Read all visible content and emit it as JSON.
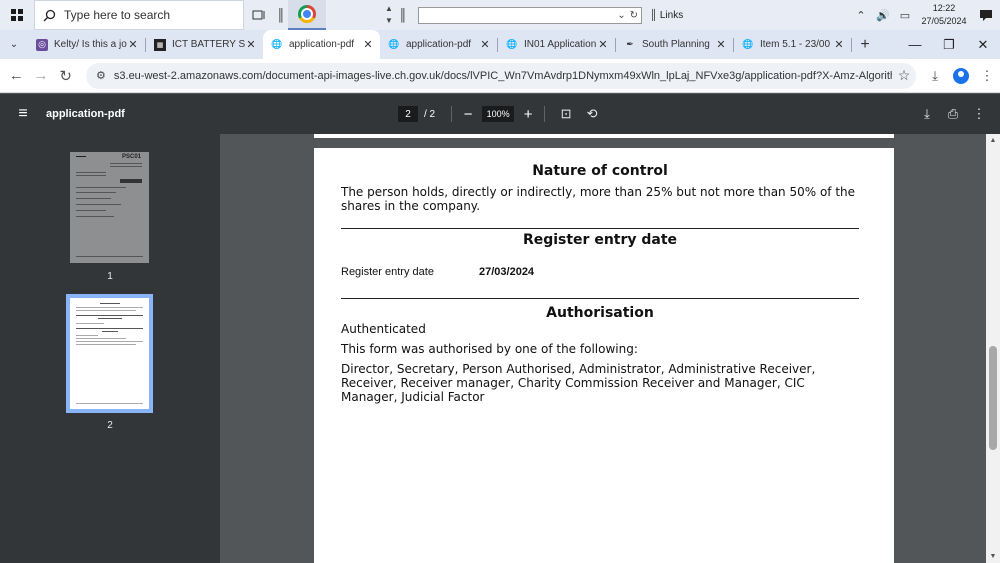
{
  "taskbar": {
    "search_placeholder": "Type here to search",
    "links_label": "Links",
    "time": "12:22",
    "date": "27/05/2024"
  },
  "tabs": [
    {
      "title": "Kelty/ Is this a jo",
      "icon": "site-icon"
    },
    {
      "title": "ICT BATTERY STO",
      "icon": "site-icon"
    },
    {
      "title": "application-pdf",
      "icon": "globe-icon",
      "active": true
    },
    {
      "title": "application-pdf",
      "icon": "globe-icon"
    },
    {
      "title": "IN01 Application",
      "icon": "globe-icon"
    },
    {
      "title": "South Planning",
      "icon": "pen-icon"
    },
    {
      "title": "Item 5.1 - 23/00",
      "icon": "globe-icon"
    }
  ],
  "address": {
    "url": "s3.eu-west-2.amazonaws.com/document-api-images-live.ch.gov.uk/docs/lVPIC_Wn7VmAvdrp1DNymxm49xWln_lpLaj_NFVxe3g/application-pdf?X-Amz-Algorithm=AWS..."
  },
  "pdf_toolbar": {
    "title": "application-pdf",
    "current_page": "2",
    "total_pages": "/ 2",
    "zoom": "100%"
  },
  "thumbnails": [
    {
      "label": "1",
      "header": "PSC01"
    },
    {
      "label": "2"
    }
  ],
  "document": {
    "nature_heading": "Nature of control",
    "nature_text": "The person holds, directly or indirectly, more than 25% but not more than 50% of the shares in the company.",
    "register_heading": "Register entry date",
    "register_label": "Register entry date",
    "register_value": "27/03/2024",
    "auth_heading": "Authorisation",
    "auth_status": "Authenticated",
    "auth_intro": "This form was authorised by one of the following:",
    "auth_list": "Director, Secretary, Person Authorised, Administrator, Administrative Receiver, Receiver, Receiver manager, Charity Commission Receiver and Manager, CIC Manager, Judicial Factor"
  }
}
